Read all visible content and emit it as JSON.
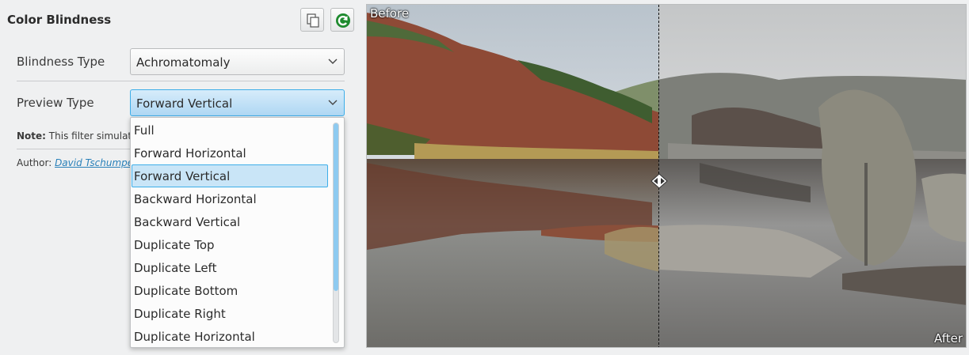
{
  "panel": {
    "title": "Color Blindness",
    "copy_icon": "copy-icon",
    "refresh_icon": "refresh-icon"
  },
  "fields": {
    "blindness_type": {
      "label": "Blindness Type",
      "value": "Achromatomaly"
    },
    "preview_type": {
      "label": "Preview Type",
      "value": "Forward Vertical"
    }
  },
  "note": {
    "label": "Note:",
    "text": "This filter simulate"
  },
  "author": {
    "label": "Author:",
    "name": "David Tschumpe"
  },
  "dropdown": {
    "options": [
      "Full",
      "Forward Horizontal",
      "Forward Vertical",
      "Backward Horizontal",
      "Backward Vertical",
      "Duplicate Top",
      "Duplicate Left",
      "Duplicate Bottom",
      "Duplicate Right",
      "Duplicate Horizontal"
    ],
    "selected_index": 2
  },
  "preview": {
    "before_label": "Before",
    "after_label": "After"
  },
  "colors": {
    "accent": "#3daee9",
    "selection_bg": "#c9e5f7",
    "link": "#2980b9"
  }
}
